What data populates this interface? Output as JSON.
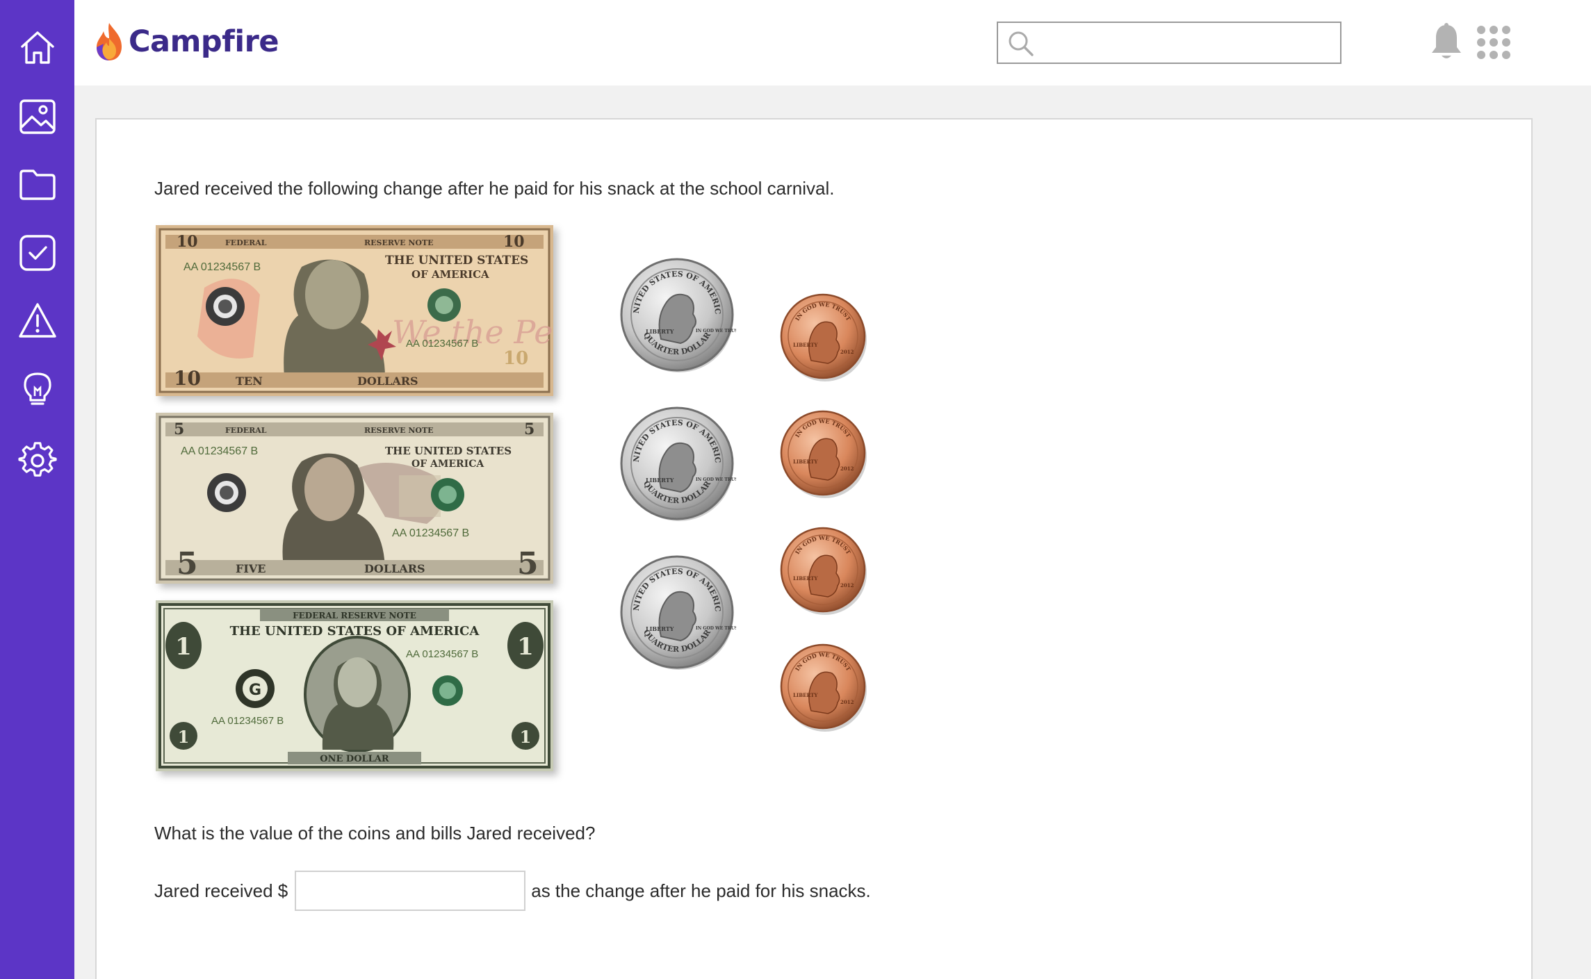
{
  "app": {
    "name": "Campfire",
    "brand_color": "#5c35c6",
    "logo_text_color": "#3b2a89"
  },
  "sidebar": {
    "items": [
      {
        "icon": "home-icon"
      },
      {
        "icon": "image-icon"
      },
      {
        "icon": "folder-icon"
      },
      {
        "icon": "checkbox-icon"
      },
      {
        "icon": "warning-icon"
      },
      {
        "icon": "lightbulb-icon"
      },
      {
        "icon": "gear-icon"
      }
    ]
  },
  "header": {
    "search": {
      "value": "",
      "placeholder": ""
    },
    "icons": [
      "bell-icon",
      "apps-grid-icon",
      "user-avatar-icon"
    ]
  },
  "question": {
    "prompt": "Jared received the following change after he paid for his snack at the school carnival.",
    "sub_question": "What is the value of the coins and bills Jared received?",
    "answer_prefix": "Jared received $",
    "answer_suffix": "as the change after he paid for his snacks.",
    "answer_value": ""
  },
  "bills": [
    {
      "denomination": "10",
      "serial": "AA 01234567 B",
      "top_left_text": "FEDERAL",
      "top_right_text": "RESERVE NOTE",
      "country_line1": "THE UNITED STATES",
      "country_line2": "OF AMERICA",
      "bottom_left_text": "TEN",
      "bottom_right_text": "DOLLARS",
      "script_text": "We the People",
      "color": "#e9c9a3"
    },
    {
      "denomination": "5",
      "serial": "AA 01234567 B",
      "top_left_text": "FEDERAL",
      "top_right_text": "RESERVE NOTE",
      "country_line1": "THE UNITED STATES",
      "country_line2": "OF AMERICA",
      "bottom_left_text": "FIVE",
      "bottom_right_text": "DOLLARS",
      "color": "#e4dcc8"
    },
    {
      "denomination": "1",
      "serial": "AA 01234567 B",
      "top_text": "FEDERAL RESERVE NOTE",
      "country_line": "THE UNITED STATES OF AMERICA",
      "bottom_text": "ONE DOLLAR",
      "seal_letter": "G",
      "color": "#e4e6d2"
    }
  ],
  "coins": {
    "quarters": {
      "count": 3,
      "top_text": "UNITED STATES OF AMERICA",
      "bottom_text": "QUARTER DOLLAR",
      "left_text": "LIBERTY",
      "right_text": "IN GOD WE TRUST",
      "color": "#c9c9c9"
    },
    "pennies": {
      "count": 4,
      "top_text": "IN GOD WE TRUST",
      "left_text": "LIBERTY",
      "right_text": "2012",
      "color": "#d9875c"
    }
  }
}
